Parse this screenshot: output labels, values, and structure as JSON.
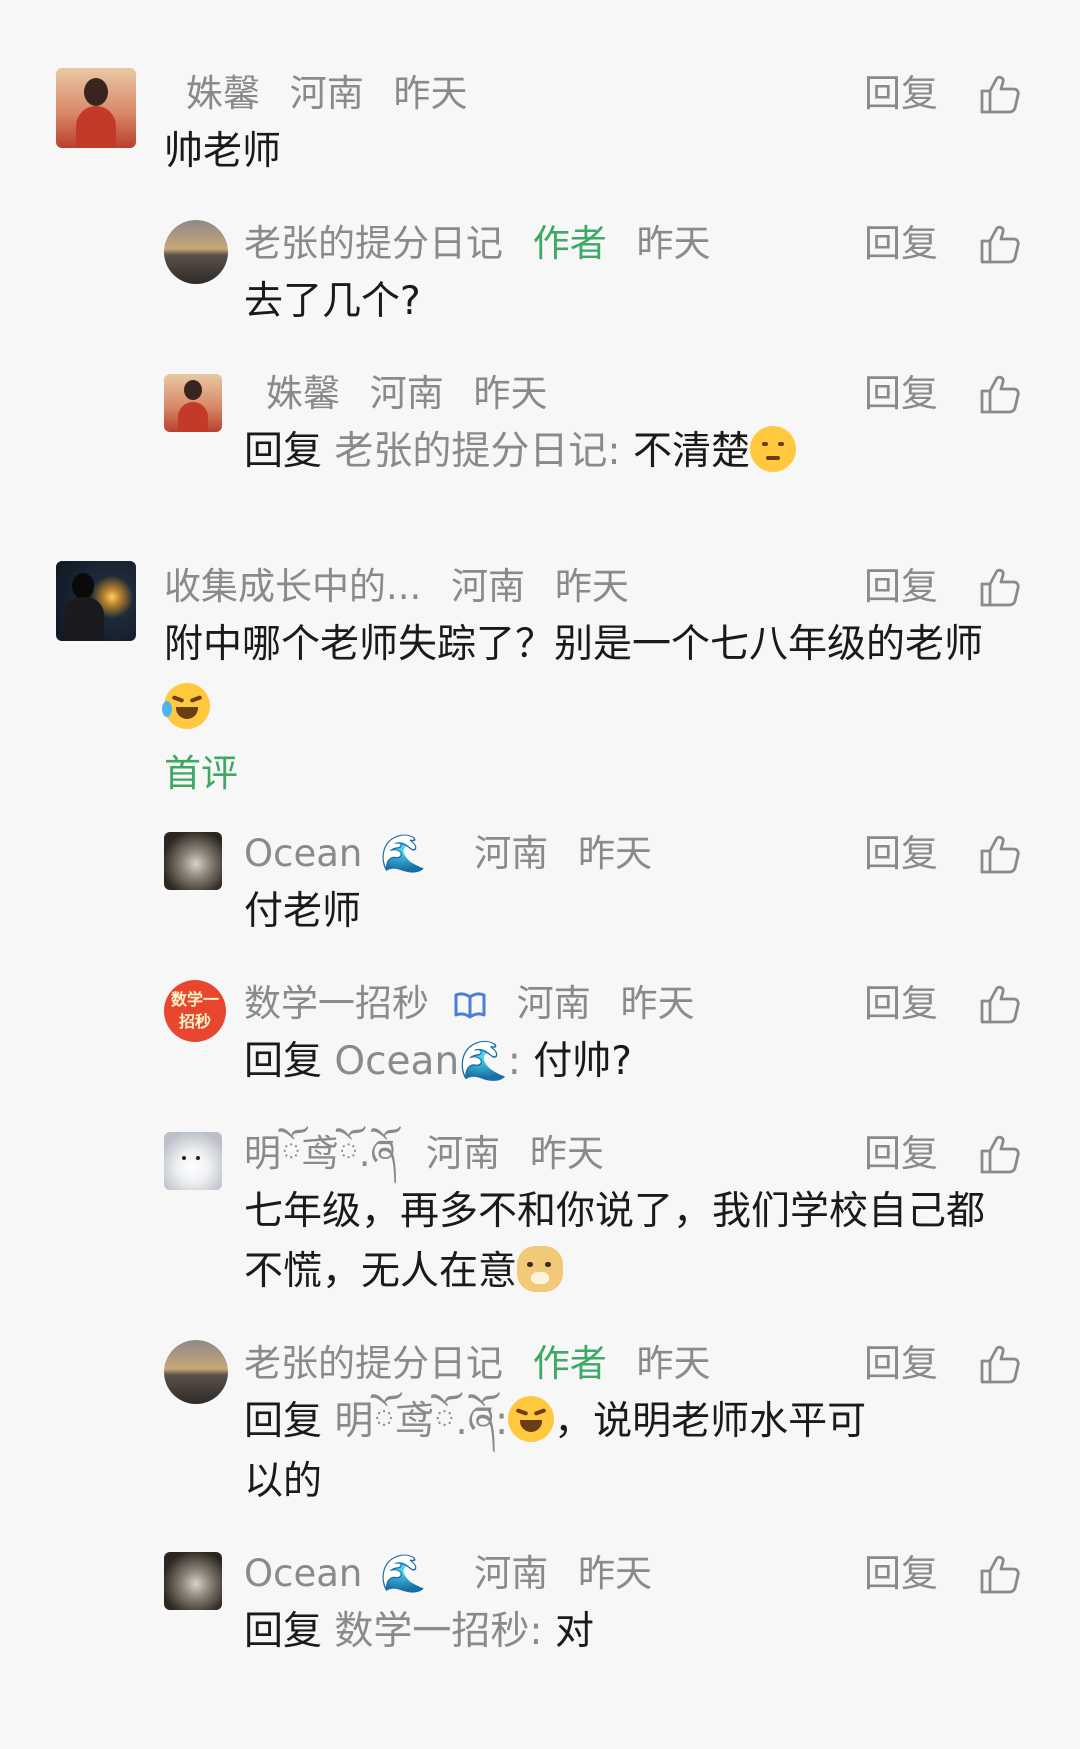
{
  "reply_label": "回复",
  "comments": [
    {
      "name": "姝馨",
      "location": "河南",
      "time": "昨天",
      "body": "帅老师"
    },
    {
      "name": "老张的提分日记",
      "badge": "作者",
      "time": "昨天",
      "body": "去了几个?"
    },
    {
      "name": "姝馨",
      "location": "河南",
      "time": "昨天",
      "reply_prefix": "回复",
      "reply_to": "老张的提分日记:",
      "body": "不清楚"
    },
    {
      "name": "收集成长中的...",
      "location": "河南",
      "time": "昨天",
      "body_line1": "附中哪个老师失踪了？别是一个七八年级的老师",
      "first_comment": "首评"
    },
    {
      "name": "Ocean",
      "location": "河南",
      "time": "昨天",
      "body": "付老师"
    },
    {
      "name": "数学一招秒",
      "location": "河南",
      "time": "昨天",
      "reply_prefix": "回复",
      "reply_to": "Ocean",
      "reply_suffix": ":",
      "body": "付帅?",
      "avatar_text_1": "数学一",
      "avatar_text_2": "招秒"
    },
    {
      "name": "明ོ鸢ོ.ཞོ",
      "location": "河南",
      "time": "昨天",
      "body_line1": "七年级，再多不和你说了，我们学校自己都",
      "body_line2": "不慌，无人在意"
    },
    {
      "name": "老张的提分日记",
      "badge": "作者",
      "time": "昨天",
      "reply_prefix": "回复",
      "reply_to": "明ོ鸢ོ.ཞོ:",
      "body_line1": "，说明老师水平可",
      "body_line2": "以的"
    },
    {
      "name": "Ocean",
      "location": "河南",
      "time": "昨天",
      "reply_prefix": "回复",
      "reply_to": "数学一招秒:",
      "body": "对"
    }
  ],
  "colors": {
    "background": "#f7f7f7",
    "meta": "#8a8a8a",
    "author": "#3fa862",
    "text": "#1a1a1a"
  }
}
